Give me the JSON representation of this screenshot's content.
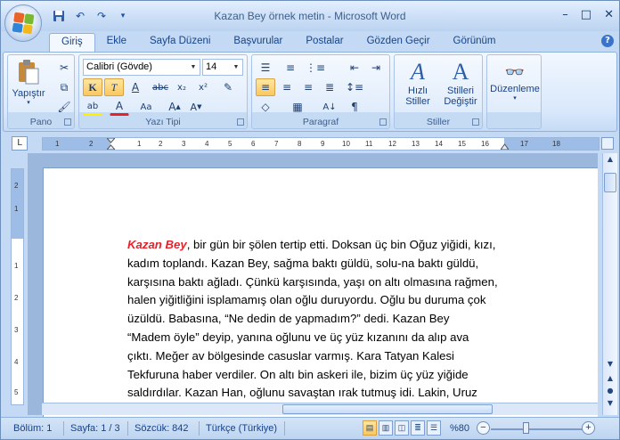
{
  "window": {
    "title": "Kazan Bey örnek metin - Microsoft Word"
  },
  "quick_access": {
    "save_icon": "save-icon",
    "undo_icon": "undo-icon",
    "redo_icon": "redo-icon",
    "customize_icon": "customize-qat-icon"
  },
  "tabs": [
    {
      "label": "Giriş",
      "active": true
    },
    {
      "label": "Ekle"
    },
    {
      "label": "Sayfa Düzeni"
    },
    {
      "label": "Başvurular"
    },
    {
      "label": "Postalar"
    },
    {
      "label": "Gözden Geçir"
    },
    {
      "label": "Görünüm"
    }
  ],
  "ribbon": {
    "clipboard": {
      "label": "Pano",
      "paste_label": "Yapıştır"
    },
    "font": {
      "label": "Yazı Tipi",
      "font_name": "Calibri (Gövde)",
      "font_size": "14"
    },
    "paragraph": {
      "label": "Paragraf"
    },
    "styles": {
      "label": "Stiller",
      "quick_styles_line1": "Hızlı",
      "quick_styles_line2": "Stiller",
      "change_styles_line1": "Stilleri",
      "change_styles_line2": "Değiştir"
    },
    "editing": {
      "label": "Düzenleme"
    }
  },
  "ruler": {
    "top_ticks": [
      "1",
      "2",
      "1",
      "2",
      "3",
      "4",
      "5",
      "6",
      "7",
      "8",
      "9",
      "10",
      "11",
      "12",
      "13",
      "14",
      "15",
      "16",
      "17",
      "18"
    ],
    "left_ticks": [
      "2",
      "1",
      "1",
      "2",
      "3",
      "4",
      "5"
    ]
  },
  "document": {
    "first_word": "Kazan Bey",
    "first_line_rest": ", bir gün bir şölen tertip etti. Doksan üç bin Oğuz yiğidi, kızı,",
    "lines": [
      "kadım toplandı. Kazan Bey, sağma baktı güldü, solu-na baktı güldü,",
      "karşısına baktı ağladı. Çünkü karşısında, yaşı on altı olmasına rağmen,",
      "halen yiğitliğini  isplamamış  olan oğlu duruyordu. Oğlu bu duruma çok",
      "üzüldü. Babasına, “Ne dedin de yapmadım?” dedi. Kazan Bey",
      "“Madem öyle” deyip, yanına oğlunu ve üç yüz kızanını da alıp ava",
      "çıktı. Meğer av bölgesinde casuslar varmış. Kara Tatyan Kalesi",
      "Tekfuruna haber verdiler. On altı bin askeri ile, bizim üç yüz yiğide",
      "saldırdılar. Kazan Han, oğlunu savaştan ırak tutmuş idi. Lakin, Uruz"
    ]
  },
  "status": {
    "section": "Bölüm: 1",
    "page": "Sayfa: 1 / 3",
    "words": "Sözcük: 842",
    "language": "Türkçe (Türkiye)",
    "zoom": "%80"
  }
}
